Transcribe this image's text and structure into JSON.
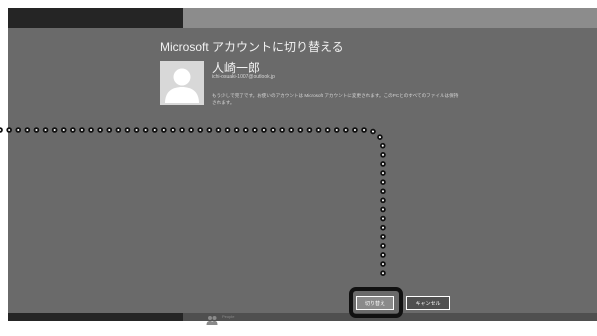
{
  "dialog": {
    "title": "Microsoft アカウントに切り替える",
    "user_name": "人崎一郎",
    "user_email": "ichi-osuaki-1007@outlook.jp",
    "description": "もう少しで完了です。お使いのアカウントは Microsoft アカウントに変更されます。このPCとのすべてのファイルは保持されます。"
  },
  "buttons": {
    "switch_label": "切り替え",
    "cancel_label": "キャンセル"
  },
  "taskbar": {
    "label": "People"
  },
  "colors": {
    "screen_background": "#6a6a6a",
    "highlight_frame": "#111111",
    "dotted_line": "#111111"
  }
}
